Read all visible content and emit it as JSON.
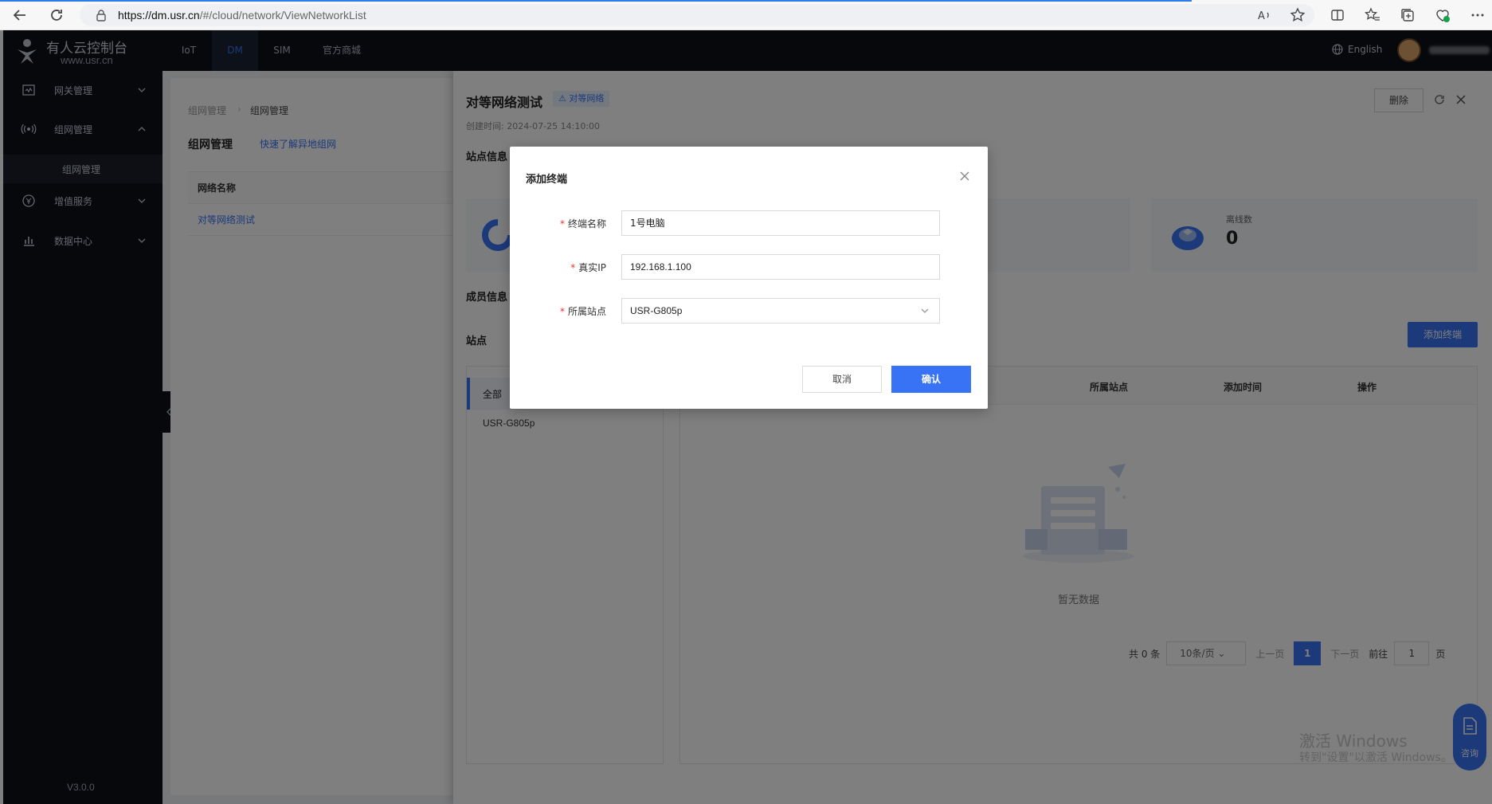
{
  "browser": {
    "url_host": "https://dm.usr.cn",
    "url_path": "/#/cloud/network/ViewNetworkList"
  },
  "topnav": {
    "logo_title": "有人云控制台",
    "logo_sub": "www.usr.cn",
    "items": [
      {
        "label": "IoT"
      },
      {
        "label": "DM"
      },
      {
        "label": "SIM"
      },
      {
        "label": "官方商城"
      }
    ],
    "language": "English"
  },
  "sidebar": {
    "items": [
      {
        "label": "网关管理"
      },
      {
        "label": "组网管理"
      },
      {
        "label": "增值服务"
      },
      {
        "label": "数据中心"
      }
    ],
    "sub_item": "组网管理",
    "version": "V3.0.0"
  },
  "main": {
    "breadcrumb": [
      "组网管理",
      "组网管理"
    ],
    "title": "组网管理",
    "help_link": "快速了解异地组网",
    "table_header": "网络名称",
    "table_rows": [
      "对等网络测试"
    ]
  },
  "drawer": {
    "title": "对等网络测试",
    "tag": "对等网络",
    "created": "创建时间: 2024-07-25 14:10:00",
    "delete_label": "删除",
    "section_site_info": "站点信息",
    "offline_label": "离线数",
    "offline_count": "0",
    "section_members": "成员信息",
    "section_site": "站点",
    "add_terminal": "添加终端",
    "sites": [
      "全部",
      "USR-G805p"
    ],
    "member_columns": [
      "所属站点",
      "添加时间",
      "操作"
    ],
    "empty_text": "暂无数据",
    "pager": {
      "total": "共 0 条",
      "page_size": "10条/页",
      "prev": "上一页",
      "current": "1",
      "next": "下一页",
      "goto": "前往",
      "goto_value": "1",
      "page_unit": "页"
    }
  },
  "dialog": {
    "title": "添加终端",
    "fields": [
      {
        "label": "终端名称",
        "value": "1号电脑"
      },
      {
        "label": "真实IP",
        "value": "192.168.1.100"
      },
      {
        "label": "所属站点",
        "value": "USR-G805p"
      }
    ],
    "cancel": "取消",
    "confirm": "确认"
  },
  "watermark": {
    "line1": "激活 Windows",
    "line2": "转到\"设置\"以激活 Windows。"
  },
  "consult_label": "咨询",
  "colors": {
    "accent": "#3873f5",
    "nav_bg": "#0f1119",
    "required": "#e33333"
  }
}
